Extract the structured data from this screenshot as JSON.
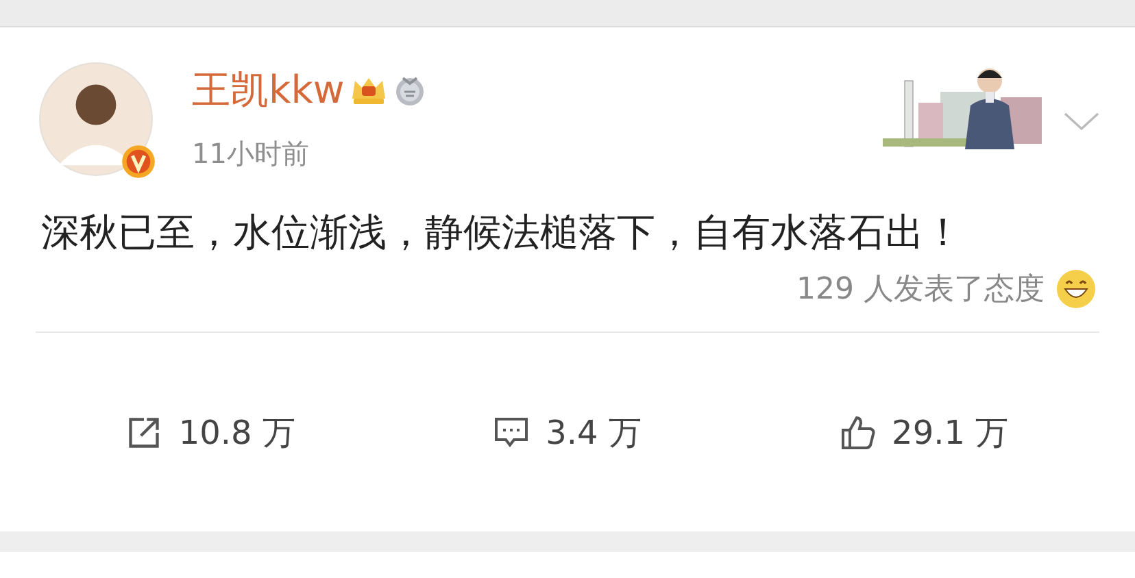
{
  "post": {
    "author": "王凯kkw",
    "time": "11小时前",
    "verified": true,
    "text": "深秋已至，水位渐浅，静候法槌落下，自有水落石出！",
    "reactions_summary": "129 人发表了态度",
    "actions": [
      {
        "kind": "repost",
        "count": "10.8 万"
      },
      {
        "kind": "comment",
        "count": "3.4 万"
      },
      {
        "kind": "like",
        "count": "29.1 万"
      }
    ]
  }
}
